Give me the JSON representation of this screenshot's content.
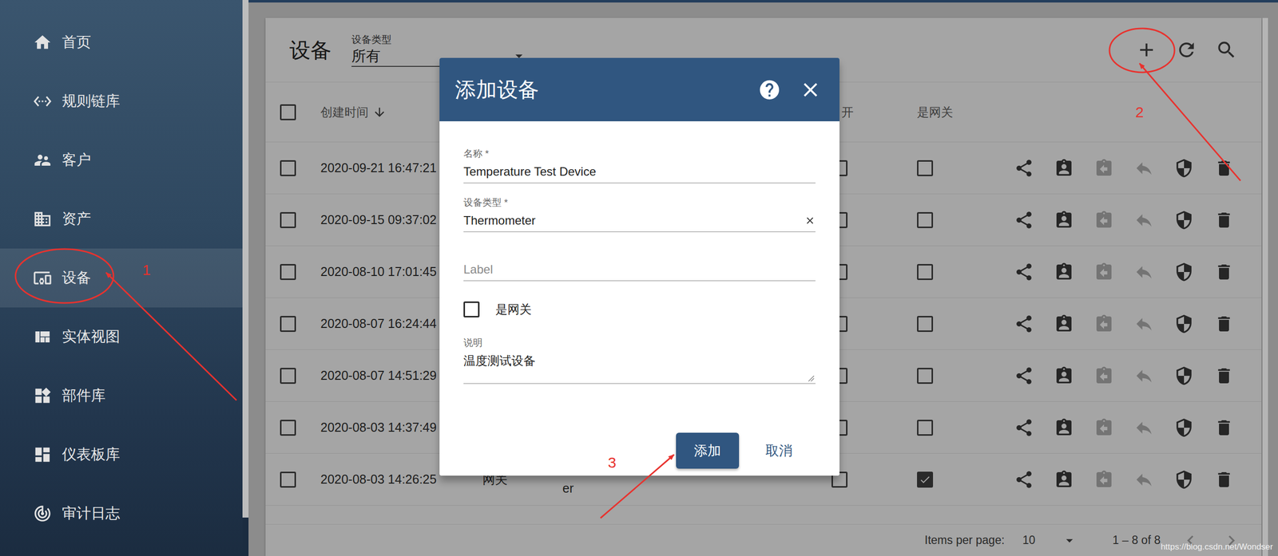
{
  "sidebar": {
    "items": [
      {
        "label": "首页",
        "selected": false
      },
      {
        "label": "规则链库",
        "selected": false
      },
      {
        "label": "客户",
        "selected": false
      },
      {
        "label": "资产",
        "selected": false
      },
      {
        "label": "设备",
        "selected": true
      },
      {
        "label": "实体视图",
        "selected": false
      },
      {
        "label": "部件库",
        "selected": false
      },
      {
        "label": "仪表板库",
        "selected": false
      },
      {
        "label": "审计日志",
        "selected": false
      }
    ]
  },
  "page": {
    "title": "设备",
    "filter": {
      "label": "设备类型",
      "value": "所有"
    }
  },
  "table": {
    "header_checked": false,
    "columns": [
      {
        "label": "创建时间"
      },
      {
        "label": "开"
      },
      {
        "label": "是网关"
      }
    ],
    "actions": [
      {
        "kind": "share",
        "disabled": false
      },
      {
        "kind": "assign",
        "disabled": false
      },
      {
        "kind": "unassign",
        "disabled": true
      },
      {
        "kind": "public",
        "disabled": true
      },
      {
        "kind": "credentials",
        "disabled": false
      },
      {
        "kind": "delete",
        "disabled": false
      }
    ],
    "rows": [
      {
        "checked": false,
        "created": "2020-09-21 16:47:21",
        "name": "",
        "type": "",
        "public": false,
        "gateway": false
      },
      {
        "checked": false,
        "created": "2020-09-15 09:37:02",
        "name": "",
        "type": "",
        "public": false,
        "gateway": false
      },
      {
        "checked": false,
        "created": "2020-08-10 17:01:45",
        "name": "",
        "type": "",
        "public": false,
        "gateway": false
      },
      {
        "checked": false,
        "created": "2020-08-07 16:24:44",
        "name": "",
        "type": "",
        "public": false,
        "gateway": false
      },
      {
        "checked": false,
        "created": "2020-08-07 14:51:29",
        "name": "",
        "type": "",
        "public": false,
        "gateway": false
      },
      {
        "checked": false,
        "created": "2020-08-03 14:37:49",
        "name": "",
        "type": "",
        "public": false,
        "gateway": false
      },
      {
        "checked": false,
        "created": "2020-08-03 14:26:25",
        "name": "网关",
        "type": "Thermometer",
        "public": false,
        "gateway": true
      }
    ]
  },
  "pagination": {
    "label": "Items per page:",
    "page_size": "10",
    "range": "1 – 8 of 8"
  },
  "dialog": {
    "title": "添加设备",
    "fields": [
      {
        "kind": "text",
        "label": "名称 *",
        "value": "Temperature Test Device",
        "placeholder": ""
      },
      {
        "kind": "select",
        "label": "设备类型 *",
        "value": "Thermometer",
        "placeholder": ""
      },
      {
        "kind": "text",
        "label": "",
        "value": "",
        "placeholder": "Label"
      },
      {
        "kind": "checkbox",
        "label": "是网关",
        "checked": false
      },
      {
        "kind": "textarea",
        "label": "说明",
        "value": "温度测试设备",
        "placeholder": ""
      }
    ],
    "buttons": [
      {
        "label": "添加",
        "primary": true
      },
      {
        "label": "取消",
        "primary": false
      }
    ]
  },
  "annotations": [
    {
      "label": "1"
    },
    {
      "label": "2"
    },
    {
      "label": "3"
    }
  ],
  "watermark": "https://blog.csdn.net/Wondser"
}
